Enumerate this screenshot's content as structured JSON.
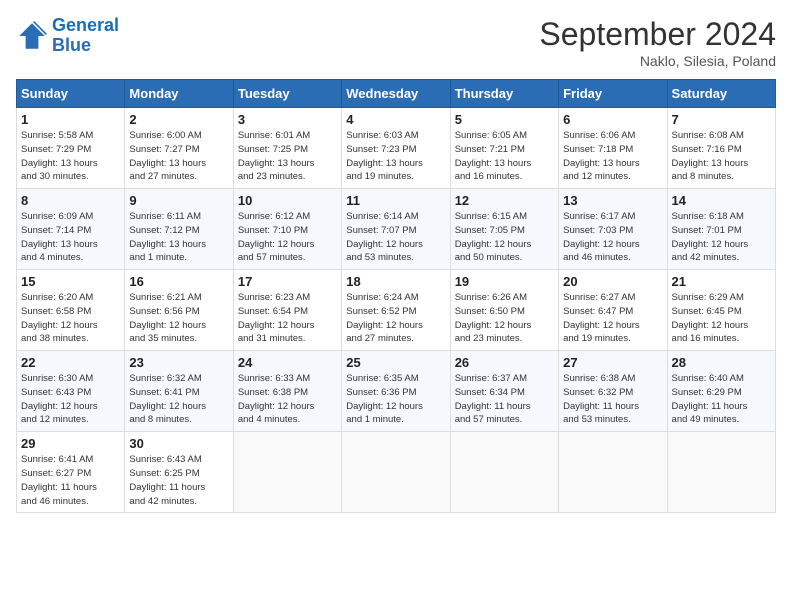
{
  "header": {
    "logo_general": "General",
    "logo_blue": "Blue",
    "month_title": "September 2024",
    "location": "Naklo, Silesia, Poland"
  },
  "days_of_week": [
    "Sunday",
    "Monday",
    "Tuesday",
    "Wednesday",
    "Thursday",
    "Friday",
    "Saturday"
  ],
  "weeks": [
    [
      {
        "num": "1",
        "info": "Sunrise: 5:58 AM\nSunset: 7:29 PM\nDaylight: 13 hours\nand 30 minutes."
      },
      {
        "num": "2",
        "info": "Sunrise: 6:00 AM\nSunset: 7:27 PM\nDaylight: 13 hours\nand 27 minutes."
      },
      {
        "num": "3",
        "info": "Sunrise: 6:01 AM\nSunset: 7:25 PM\nDaylight: 13 hours\nand 23 minutes."
      },
      {
        "num": "4",
        "info": "Sunrise: 6:03 AM\nSunset: 7:23 PM\nDaylight: 13 hours\nand 19 minutes."
      },
      {
        "num": "5",
        "info": "Sunrise: 6:05 AM\nSunset: 7:21 PM\nDaylight: 13 hours\nand 16 minutes."
      },
      {
        "num": "6",
        "info": "Sunrise: 6:06 AM\nSunset: 7:18 PM\nDaylight: 13 hours\nand 12 minutes."
      },
      {
        "num": "7",
        "info": "Sunrise: 6:08 AM\nSunset: 7:16 PM\nDaylight: 13 hours\nand 8 minutes."
      }
    ],
    [
      {
        "num": "8",
        "info": "Sunrise: 6:09 AM\nSunset: 7:14 PM\nDaylight: 13 hours\nand 4 minutes."
      },
      {
        "num": "9",
        "info": "Sunrise: 6:11 AM\nSunset: 7:12 PM\nDaylight: 13 hours\nand 1 minute."
      },
      {
        "num": "10",
        "info": "Sunrise: 6:12 AM\nSunset: 7:10 PM\nDaylight: 12 hours\nand 57 minutes."
      },
      {
        "num": "11",
        "info": "Sunrise: 6:14 AM\nSunset: 7:07 PM\nDaylight: 12 hours\nand 53 minutes."
      },
      {
        "num": "12",
        "info": "Sunrise: 6:15 AM\nSunset: 7:05 PM\nDaylight: 12 hours\nand 50 minutes."
      },
      {
        "num": "13",
        "info": "Sunrise: 6:17 AM\nSunset: 7:03 PM\nDaylight: 12 hours\nand 46 minutes."
      },
      {
        "num": "14",
        "info": "Sunrise: 6:18 AM\nSunset: 7:01 PM\nDaylight: 12 hours\nand 42 minutes."
      }
    ],
    [
      {
        "num": "15",
        "info": "Sunrise: 6:20 AM\nSunset: 6:58 PM\nDaylight: 12 hours\nand 38 minutes."
      },
      {
        "num": "16",
        "info": "Sunrise: 6:21 AM\nSunset: 6:56 PM\nDaylight: 12 hours\nand 35 minutes."
      },
      {
        "num": "17",
        "info": "Sunrise: 6:23 AM\nSunset: 6:54 PM\nDaylight: 12 hours\nand 31 minutes."
      },
      {
        "num": "18",
        "info": "Sunrise: 6:24 AM\nSunset: 6:52 PM\nDaylight: 12 hours\nand 27 minutes."
      },
      {
        "num": "19",
        "info": "Sunrise: 6:26 AM\nSunset: 6:50 PM\nDaylight: 12 hours\nand 23 minutes."
      },
      {
        "num": "20",
        "info": "Sunrise: 6:27 AM\nSunset: 6:47 PM\nDaylight: 12 hours\nand 19 minutes."
      },
      {
        "num": "21",
        "info": "Sunrise: 6:29 AM\nSunset: 6:45 PM\nDaylight: 12 hours\nand 16 minutes."
      }
    ],
    [
      {
        "num": "22",
        "info": "Sunrise: 6:30 AM\nSunset: 6:43 PM\nDaylight: 12 hours\nand 12 minutes."
      },
      {
        "num": "23",
        "info": "Sunrise: 6:32 AM\nSunset: 6:41 PM\nDaylight: 12 hours\nand 8 minutes."
      },
      {
        "num": "24",
        "info": "Sunrise: 6:33 AM\nSunset: 6:38 PM\nDaylight: 12 hours\nand 4 minutes."
      },
      {
        "num": "25",
        "info": "Sunrise: 6:35 AM\nSunset: 6:36 PM\nDaylight: 12 hours\nand 1 minute."
      },
      {
        "num": "26",
        "info": "Sunrise: 6:37 AM\nSunset: 6:34 PM\nDaylight: 11 hours\nand 57 minutes."
      },
      {
        "num": "27",
        "info": "Sunrise: 6:38 AM\nSunset: 6:32 PM\nDaylight: 11 hours\nand 53 minutes."
      },
      {
        "num": "28",
        "info": "Sunrise: 6:40 AM\nSunset: 6:29 PM\nDaylight: 11 hours\nand 49 minutes."
      }
    ],
    [
      {
        "num": "29",
        "info": "Sunrise: 6:41 AM\nSunset: 6:27 PM\nDaylight: 11 hours\nand 46 minutes."
      },
      {
        "num": "30",
        "info": "Sunrise: 6:43 AM\nSunset: 6:25 PM\nDaylight: 11 hours\nand 42 minutes."
      },
      null,
      null,
      null,
      null,
      null
    ]
  ]
}
